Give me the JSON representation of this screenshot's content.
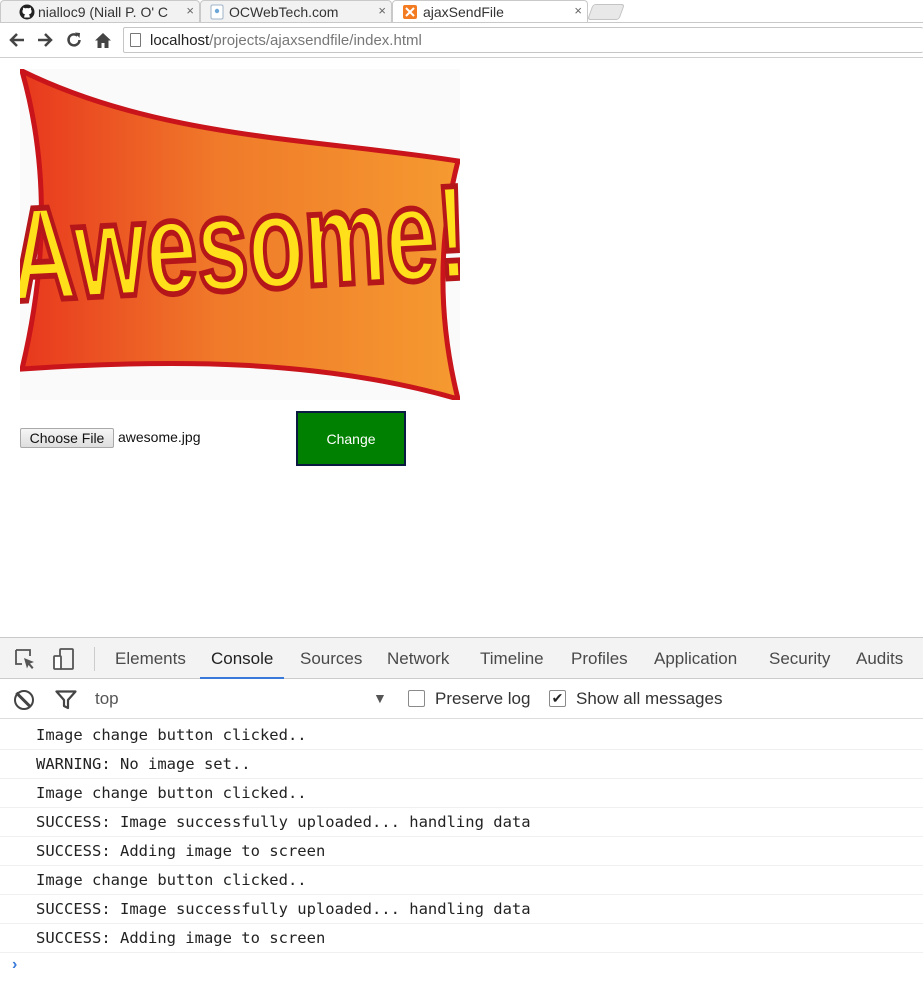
{
  "browser": {
    "tabs": [
      {
        "title": "nialloc9 (Niall P. O' C",
        "icon": "github-icon",
        "active": false
      },
      {
        "title": "OCWebTech.com",
        "icon": "site-icon",
        "active": false
      },
      {
        "title": "ajaxSendFile",
        "icon": "xampp-icon",
        "active": true
      }
    ],
    "close_glyph": "×",
    "url_host": "localhost",
    "url_path": "/projects/ajaxsendfile/index.html"
  },
  "page": {
    "banner_text": "Awesome!",
    "choose_file_label": "Choose File",
    "file_name": "awesome.jpg",
    "change_label": "Change",
    "accent": "#008000"
  },
  "devtools": {
    "tabs": [
      "Elements",
      "Console",
      "Sources",
      "Network",
      "Timeline",
      "Profiles",
      "Application",
      "Security",
      "Audits"
    ],
    "active_tab": "Console",
    "context": "top",
    "preserve_log_label": "Preserve log",
    "preserve_log_checked": false,
    "show_all_label": "Show all messages",
    "show_all_checked": true,
    "messages": [
      "Image change button clicked..",
      "WARNING: No image set..",
      "Image change button clicked..",
      "SUCCESS: Image successfully uploaded... handling data",
      "SUCCESS: Adding image to screen",
      "Image change button clicked..",
      "SUCCESS: Image successfully uploaded... handling data",
      "SUCCESS: Adding image to screen"
    ],
    "prompt_glyph": "›",
    "accent": "#3879d9"
  }
}
